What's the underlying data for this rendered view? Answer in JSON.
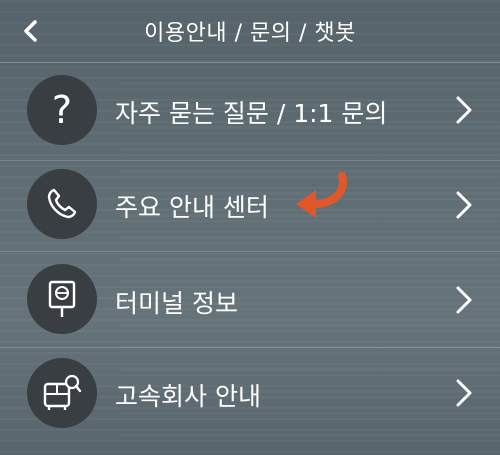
{
  "header": {
    "title": "이용안내 / 문의 / 챗봇",
    "back_icon": "chevron-left-icon"
  },
  "menu": {
    "items": [
      {
        "label": "자주 묻는 질문 / 1:1 문의",
        "icon": "question-icon",
        "icon_text": "?"
      },
      {
        "label": "주요 안내 센터",
        "icon": "phone-icon"
      },
      {
        "label": "터미널 정보",
        "icon": "terminal-sign-icon"
      },
      {
        "label": "고속회사 안내",
        "icon": "bus-search-icon"
      }
    ]
  },
  "colors": {
    "icon_circle": "#393e42",
    "text": "#ffffff",
    "highlight_arrow": "#e2572a"
  }
}
